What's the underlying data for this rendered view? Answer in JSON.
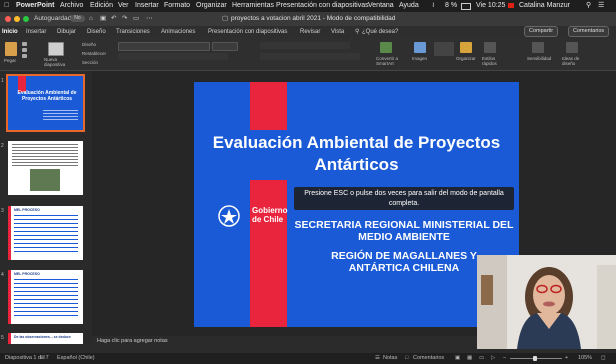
{
  "menubar": {
    "app": "PowerPoint",
    "items": [
      "Archivo",
      "Edición",
      "Ver",
      "Insertar",
      "Formato",
      "Organizar",
      "Herramientas",
      "Presentación con diapositivas",
      "Ventana",
      "Ayuda"
    ],
    "battery": "8 %",
    "clock": "Vie 10:25",
    "user": "Catalina Manzur"
  },
  "titlebar": {
    "autosave": "Autoguardado",
    "autosave_state": "No",
    "title": "proyectos a votacion abril 2021 - Modo de compatibilidad"
  },
  "tabs": {
    "items": [
      "Inicio",
      "Insertar",
      "Dibujar",
      "Diseño",
      "Transiciones",
      "Animaciones",
      "Presentación con diapositivas",
      "Revisar",
      "Vista",
      "¿Qué desea?"
    ],
    "share": "Compartir",
    "comments": "Comentarios"
  },
  "ribbon": {
    "paste": "Pegar",
    "new_slide": "Nueva diapositiva",
    "layout": "Diseño",
    "reset": "Restablecer",
    "section": "Sección",
    "convert": "Convertir a SmartArt",
    "image": "Imagen",
    "arrange": "Organizar",
    "quick_styles": "Estilos rápidos",
    "sensitivity": "Sensibilidad",
    "design_ideas": "Ideas de diseño"
  },
  "slide": {
    "title": "Evaluación Ambiental de Proyectos Antárticos",
    "escape_msg": "Presione ESC o pulse dos veces para salir del modo de pantalla completa.",
    "subtitle1": "SECRETARIA REGIONAL MINISTERIAL DEL MEDIO AMBIENTE",
    "subtitle2": "REGIÓN DE MAGALLANES Y ANTÁRTICA CHILENA",
    "logo_text": "Gobierno de Chile"
  },
  "thumbs": {
    "t1_title": "Evaluación Ambiental de Proyectos Antárticos",
    "t3_title": "MEL PROCESO",
    "t4_title": "MEL PROCESO",
    "t5_title": "De las observaciones... se deduce"
  },
  "notes": {
    "placeholder": "Haga clic para agregar notas"
  },
  "status": {
    "slide_info": "Diapositiva 1 de 7",
    "language": "Español (Chile)",
    "notes": "Notas",
    "comments": "Comentarios",
    "zoom": "105%"
  },
  "colors": {
    "accent": "#c43e1c",
    "slide_blue": "#1a5ad6",
    "flag_red": "#e8253c",
    "selection": "#e8682c"
  }
}
